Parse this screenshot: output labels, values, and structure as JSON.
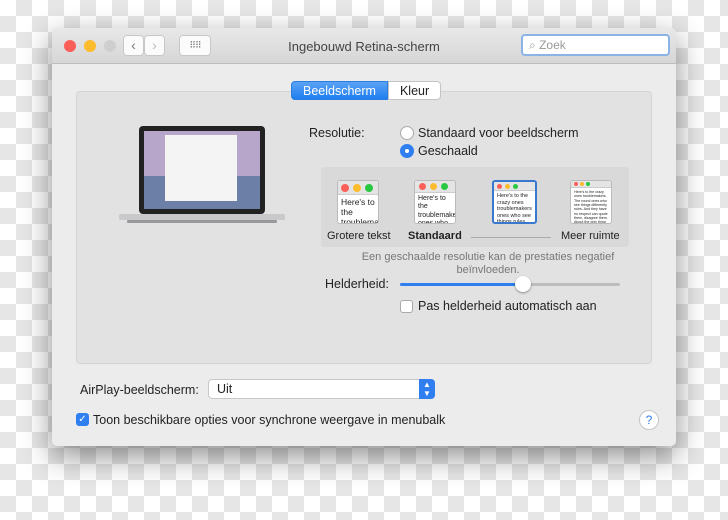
{
  "window": {
    "title": "Ingebouwd Retina-scherm",
    "search_placeholder": "Zoek"
  },
  "tabs": [
    {
      "label": "Beeldscherm",
      "selected": true
    },
    {
      "label": "Kleur",
      "selected": false
    }
  ],
  "resolution": {
    "label": "Resolutie:",
    "options": [
      {
        "label": "Standaard voor beeldscherm",
        "selected": false
      },
      {
        "label": "Geschaald",
        "selected": true
      }
    ]
  },
  "scales": [
    {
      "label": "Grotere tekst",
      "preview": "Here's to the troublemakers"
    },
    {
      "label": "Standaard",
      "preview": "Here's to the troublemakers ones who see"
    },
    {
      "label": "",
      "preview": "Here's to the crazy ones troublemakers ones who see things rules. And they"
    },
    {
      "label": "Meer ruimte",
      "preview": "Here's to the crazy ones troublemakers. The round ones who see things differently rules. And they have no respect can quote them, disagree them. About the only thing Because they change things"
    }
  ],
  "scale_selected": 2,
  "warning": "Een geschaalde resolutie kan de prestaties negatief beïnvloeden.",
  "brightness": {
    "label": "Helderheid:",
    "value": 0.56,
    "auto_label": "Pas helderheid automatisch aan",
    "auto": false
  },
  "airplay": {
    "label": "AirPlay-beeldscherm:",
    "value": "Uit"
  },
  "menubar": {
    "label": "Toon beschikbare opties voor synchrone weergave in menubalk",
    "checked": true
  },
  "help": "?"
}
